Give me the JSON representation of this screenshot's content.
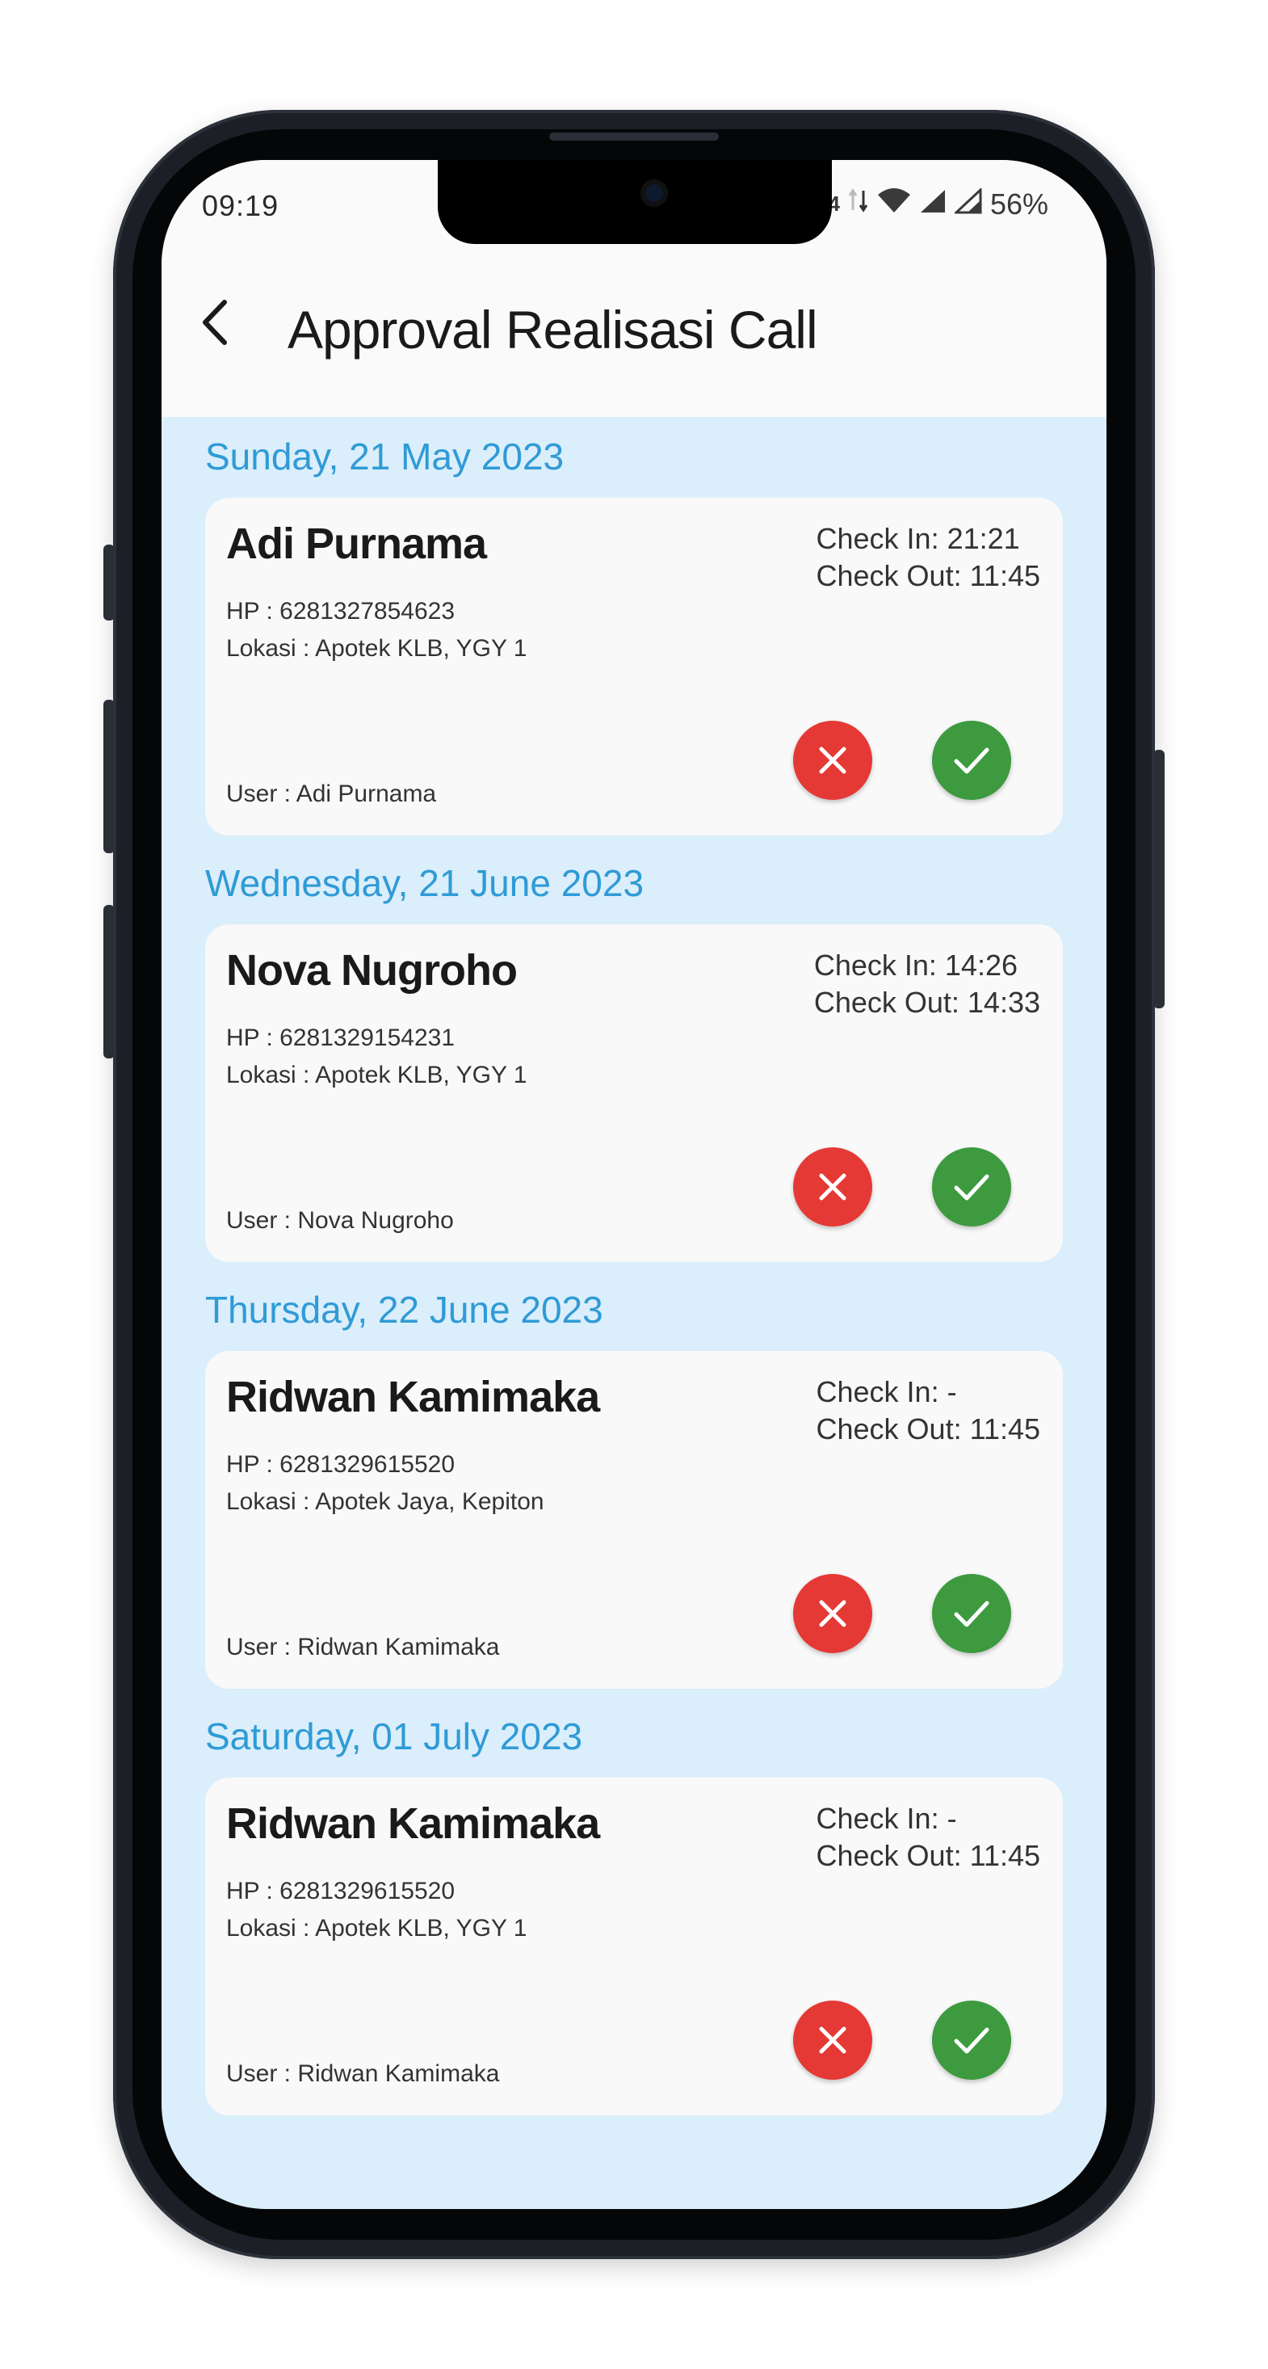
{
  "status_bar": {
    "time": "09:19",
    "battery": "56%",
    "network_speed": "4",
    "icons": [
      "data-arrows-icon",
      "wifi-icon",
      "signal-icon",
      "signal-icon"
    ]
  },
  "header": {
    "title": "Approval Realisasi Call",
    "back_icon": "back-arrow-icon"
  },
  "colors": {
    "accent": "#2f9bd6",
    "list_background": "#dbeefb",
    "reject": "#e53935",
    "approve": "#3d9a3f"
  },
  "entries": [
    {
      "date": "Sunday, 21 May 2023",
      "name": "Adi Purnama",
      "check_in": "Check In: 21:21",
      "check_out": "Check Out: 11:45",
      "hp": "HP : 6281327854623",
      "lokasi": "Lokasi : Apotek KLB, YGY 1",
      "user": "User : Adi Purnama"
    },
    {
      "date": "Wednesday, 21 June 2023",
      "name": "Nova Nugroho",
      "check_in": "Check In: 14:26",
      "check_out": "Check Out: 14:33",
      "hp": "HP : 6281329154231",
      "lokasi": "Lokasi : Apotek KLB, YGY 1",
      "user": "User : Nova Nugroho"
    },
    {
      "date": "Thursday, 22 June 2023",
      "name": "Ridwan Kamimaka",
      "check_in": "Check In: -",
      "check_out": "Check Out: 11:45",
      "hp": "HP : 6281329615520",
      "lokasi": "Lokasi : Apotek Jaya, Kepiton",
      "user": "User : Ridwan Kamimaka"
    },
    {
      "date": "Saturday, 01 July 2023",
      "name": "Ridwan Kamimaka",
      "check_in": "Check In: -",
      "check_out": "Check Out: 11:45",
      "hp": "HP : 6281329615520",
      "lokasi": "Lokasi : Apotek KLB, YGY 1",
      "user": "User : Ridwan Kamimaka"
    }
  ]
}
